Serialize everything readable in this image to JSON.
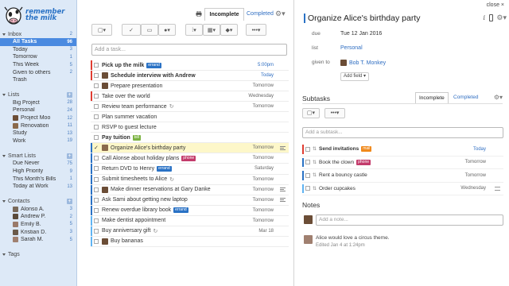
{
  "colors": {
    "sidebar_bg": "#dde9f7",
    "active": "#4a8ae0",
    "link": "#2f6ec2",
    "priority1": "#e03c31",
    "priority2": "#2a72c5",
    "priority3": "#5fb3f2",
    "tag_green": "#7cb342",
    "tag_blue": "#2a72c5",
    "tag_phone": "#c33b6b",
    "tag_mall": "#f0891b"
  },
  "logo": {
    "line1": "remember",
    "line2": "the milk"
  },
  "sidebar": {
    "inbox": {
      "label": "Inbox",
      "count": "2",
      "icon": "plus-icon",
      "items": [
        {
          "label": "All Tasks",
          "count": "96",
          "active": true
        },
        {
          "label": "Today",
          "count": "3"
        },
        {
          "label": "Tomorrow",
          "count": "1"
        },
        {
          "label": "This Week",
          "count": "5"
        },
        {
          "label": "Given to others",
          "count": "2"
        },
        {
          "label": "Trash",
          "count": ""
        }
      ]
    },
    "lists": {
      "label": "Lists",
      "items": [
        {
          "label": "Big Project",
          "count": "28"
        },
        {
          "label": "Personal",
          "count": "24"
        },
        {
          "label": "Project Moo",
          "count": "12",
          "avatar": "#6b4d36"
        },
        {
          "label": "Renovation",
          "count": "11",
          "avatar": "#8a6a4c"
        },
        {
          "label": "Study",
          "count": "13"
        },
        {
          "label": "Work",
          "count": "19"
        }
      ]
    },
    "smart_lists": {
      "label": "Smart Lists",
      "items": [
        {
          "label": "Due Never",
          "count": "75"
        },
        {
          "label": "High Priority",
          "count": "9"
        },
        {
          "label": "This Month's Bills",
          "count": "1"
        },
        {
          "label": "Today at Work",
          "count": "13"
        }
      ]
    },
    "contacts": {
      "label": "Contacts",
      "items": [
        {
          "label": "Alonso A.",
          "count": "3",
          "avatar": "#7a6a5a"
        },
        {
          "label": "Andrew P.",
          "count": "2",
          "avatar": "#5a4a3a"
        },
        {
          "label": "Emily B.",
          "count": "5",
          "avatar": "#9a7a6a"
        },
        {
          "label": "Kristian D.",
          "count": "3",
          "avatar": "#6a5a4a"
        },
        {
          "label": "Sarah M.",
          "count": "5",
          "avatar": "#a08070"
        }
      ]
    },
    "tags": {
      "label": "Tags"
    }
  },
  "tasklist": {
    "tab_incomplete": "Incomplete",
    "tab_completed": "Completed",
    "add_placeholder": "Add a task...",
    "toolbar": {
      "select": "▢▾",
      "complete": "✓",
      "postpone": "▭",
      "assign": "●▾",
      "priority": "⁞▾",
      "due": "▦▾",
      "tags": "◆▾",
      "more": "•••▾"
    },
    "tasks": [
      {
        "name": "Pick up the milk",
        "bold": true,
        "tag": "errand",
        "tag_color": "#2a72c5",
        "due": "5:00pm",
        "due_blue": true,
        "bar": "#e03c31"
      },
      {
        "name": "Schedule interview with Andrew",
        "bold": true,
        "avatar": "#6b4d36",
        "due": "Today",
        "due_blue": true,
        "bar": "#e03c31"
      },
      {
        "name": "Prepare presentation",
        "avatar": "#6b4d36",
        "due": "Tomorrow",
        "bar": ""
      },
      {
        "name": "Take over the world",
        "due": "Wednesday",
        "bar": "#e03c31"
      },
      {
        "name": "Review team performance",
        "repeat": true,
        "due": "Tomorrow",
        "bar": ""
      },
      {
        "name": "Plan summer vacation",
        "due": "",
        "bar": ""
      },
      {
        "name": "RSVP to guest lecture",
        "due": "",
        "bar": ""
      },
      {
        "name": "Pay tuition",
        "bold": true,
        "tag": "bill",
        "tag_color": "#7cb342",
        "due": "",
        "bar": ""
      },
      {
        "name": "Organize Alice's birthday party",
        "check": true,
        "selected": true,
        "avatar": "#8a6a4c",
        "due": "Tomorrow",
        "note": true,
        "bar": "#2a72c5"
      },
      {
        "name": "Call Alonse about holiday plans",
        "tag": "phone",
        "tag_color": "#c33b6b",
        "due": "Tomorrow",
        "bar": "#2a72c5"
      },
      {
        "name": "Return DVD to Henry",
        "tag": "errand",
        "tag_color": "#2a72c5",
        "due": "Saturday",
        "bar": "#2a72c5"
      },
      {
        "name": "Submit timesheets to Alice",
        "repeat": true,
        "due": "Tomorrow",
        "bar": "#2a72c5"
      },
      {
        "name": "Make dinner reservations at Gary Danke",
        "avatar": "#6b4d36",
        "due": "Tomorrow",
        "note": true,
        "bar": "#2a72c5"
      },
      {
        "name": "Ask Sami about getting new laptop",
        "due": "Tomorrow",
        "note": true,
        "bar": "#2a72c5"
      },
      {
        "name": "Renew overdue library book",
        "tag": "errand",
        "tag_color": "#2a72c5",
        "due": "Tomorrow",
        "bar": "#2a72c5"
      },
      {
        "name": "Make dentist appointment",
        "due": "Tomorrow",
        "bar": "#5fb3f2"
      },
      {
        "name": "Buy anniversary gift",
        "repeat": true,
        "due": "Mar 18",
        "bar": "#5fb3f2"
      },
      {
        "name": "Buy bananas",
        "avatar": "#6b4d36",
        "due": "",
        "bar": "#5fb3f2"
      }
    ]
  },
  "detail": {
    "close": "close ×",
    "title": "Organize Alice's birthday party",
    "fields": {
      "due_label": "due",
      "due_value": "Tue 12 Jan 2016",
      "list_label": "list",
      "list_value": "Personal",
      "given_label": "given to",
      "given_value": "Bob T. Monkey"
    },
    "add_field": "Add field ▾",
    "subtasks_title": "Subtasks",
    "sub_tab_incomplete": "Incomplete",
    "sub_tab_completed": "Completed",
    "add_subtask_placeholder": "Add a subtask...",
    "subtasks": [
      {
        "name": "Send invitations",
        "bold": true,
        "tag": "mail",
        "tag_color": "#f0891b",
        "due": "Today",
        "due_blue": true,
        "bar": "#e03c31"
      },
      {
        "name": "Book the clown",
        "tag": "phone",
        "tag_color": "#c33b6b",
        "due": "Tomorrow",
        "bar": "#2a72c5"
      },
      {
        "name": "Rent a bouncy castle",
        "due": "Tomorrow",
        "bar": "#2a72c5"
      },
      {
        "name": "Order cupcakes",
        "due": "Wednesday",
        "note": true,
        "bar": "#5fb3f2"
      }
    ],
    "notes_title": "Notes",
    "add_note_placeholder": "Add a note...",
    "note": {
      "text": "Alice would love a circus theme.",
      "meta": "Edited Jan 4 at 1:24pm"
    }
  }
}
